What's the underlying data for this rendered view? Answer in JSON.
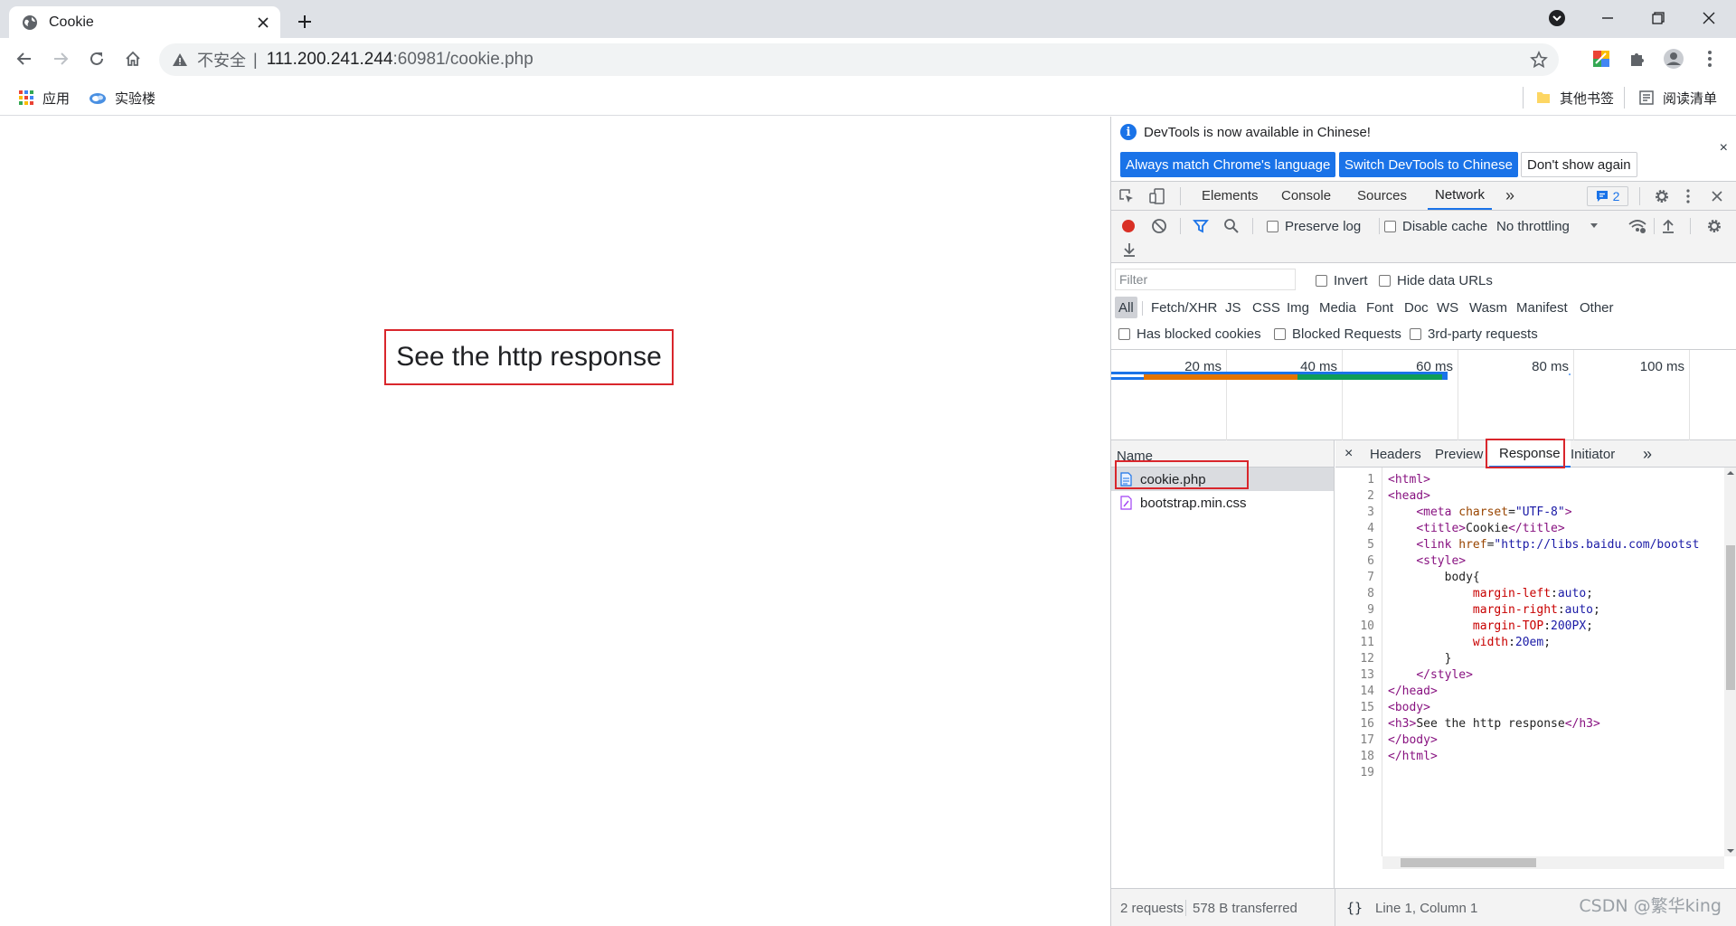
{
  "tab": {
    "title": "Cookie"
  },
  "address": {
    "security_label": "不安全",
    "separator": "|",
    "host": "111.200.241.244",
    "path": ":60981/cookie.php"
  },
  "bookmarks": {
    "apps": "应用",
    "shiyanlou": "实验楼",
    "other": "其他书签",
    "reading_list": "阅读清单"
  },
  "page": {
    "heading": "See the http response"
  },
  "devtools": {
    "info": {
      "message": "DevTools is now available in Chinese!",
      "btn_match": "Always match Chrome's language",
      "btn_switch": "Switch DevTools to Chinese",
      "btn_dismiss": "Don't show again",
      "close": "×"
    },
    "tabs": {
      "elements": "Elements",
      "console": "Console",
      "sources": "Sources",
      "network": "Network",
      "more": "»",
      "messages_count": "2"
    },
    "toolbar": {
      "preserve_log": "Preserve log",
      "disable_cache": "Disable cache",
      "throttling": "No throttling"
    },
    "filter": {
      "placeholder": "Filter",
      "invert": "Invert",
      "hide_data_urls": "Hide data URLs",
      "types": [
        "All",
        "Fetch/XHR",
        "JS",
        "CSS",
        "Img",
        "Media",
        "Font",
        "Doc",
        "WS",
        "Wasm",
        "Manifest",
        "Other"
      ],
      "has_blocked_cookies": "Has blocked cookies",
      "blocked_requests": "Blocked Requests",
      "third_party": "3rd-party requests"
    },
    "overview": {
      "ticks": [
        "20 ms",
        "40 ms",
        "60 ms",
        "80 ms",
        "100 ms"
      ]
    },
    "name_header": "Name",
    "requests": [
      {
        "name": "cookie.php",
        "type": "document"
      },
      {
        "name": "bootstrap.min.css",
        "type": "stylesheet"
      }
    ],
    "detail_tabs": {
      "close": "×",
      "headers": "Headers",
      "preview": "Preview",
      "response": "Response",
      "initiator": "Initiator",
      "more": "»"
    },
    "response_lines": [
      "<html>",
      "<head>",
      "    <meta charset=\"UTF-8\">",
      "    <title>Cookie</title>",
      "    <link href=\"http://libs.baidu.com/bootst",
      "    <style>",
      "        body{",
      "            margin-left:auto;",
      "            margin-right:auto;",
      "            margin-TOP:200PX;",
      "            width:20em;",
      "        }",
      "    </style>",
      "</head>",
      "<body>",
      "<h3>See the http response</h3>",
      "</body>",
      "</html>",
      ""
    ],
    "status": {
      "requests": "2 requests",
      "transferred": "578 B transferred",
      "format": "{}",
      "position": "Line 1, Column 1"
    }
  },
  "watermark": "CSDN @繁华king",
  "colors": {
    "accent": "#1a73e8",
    "highlight_box": "#d9262c",
    "record": "#d93025"
  }
}
